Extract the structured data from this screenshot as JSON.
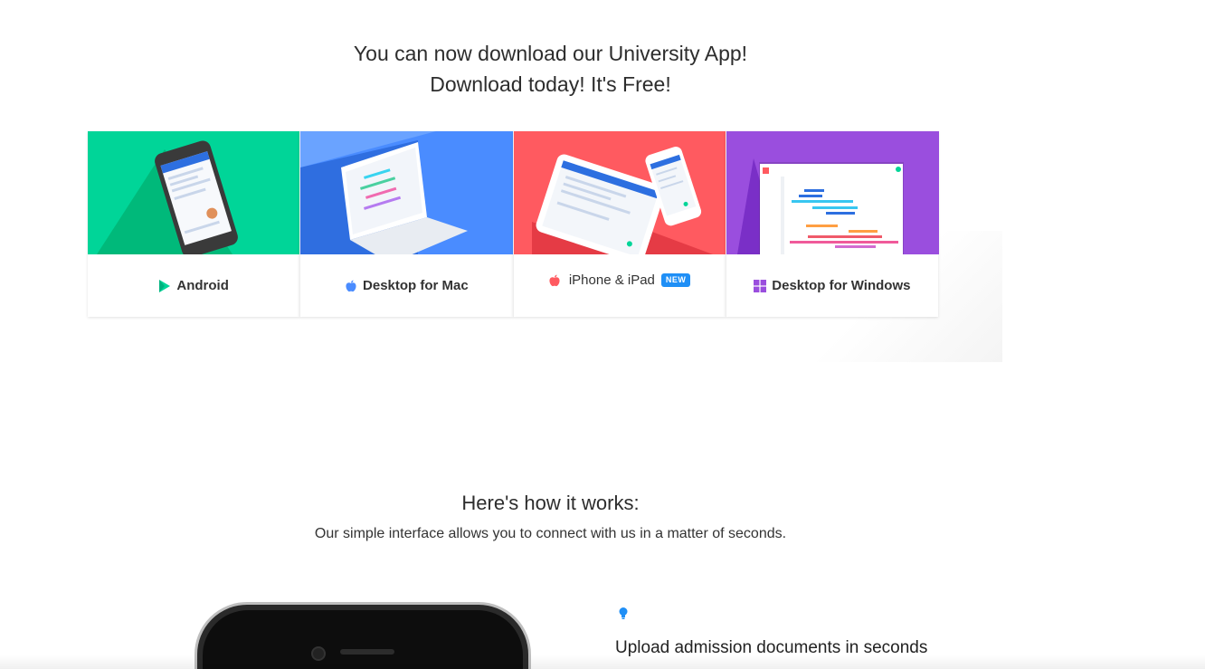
{
  "hero": {
    "line1": "You can now download our University App!",
    "line2": "Download today! It's Free!"
  },
  "downloads": [
    {
      "label": "Android",
      "icon": "play-store-icon",
      "color": "#00d598"
    },
    {
      "label": "Desktop for Mac",
      "icon": "apple-icon",
      "color": "#4a8cff"
    },
    {
      "label": "iPhone & iPad",
      "icon": "apple-icon",
      "color": "#ff5a60",
      "badge": "NEW"
    },
    {
      "label": "Desktop for Windows",
      "icon": "windows-icon",
      "color": "#9a4ede"
    }
  ],
  "how": {
    "title": "Here's how it works:",
    "subtitle": "Our simple interface allows you to connect with us in a matter of seconds."
  },
  "feature": {
    "icon": "lightbulb-icon",
    "title": "Upload admission documents in seconds"
  }
}
